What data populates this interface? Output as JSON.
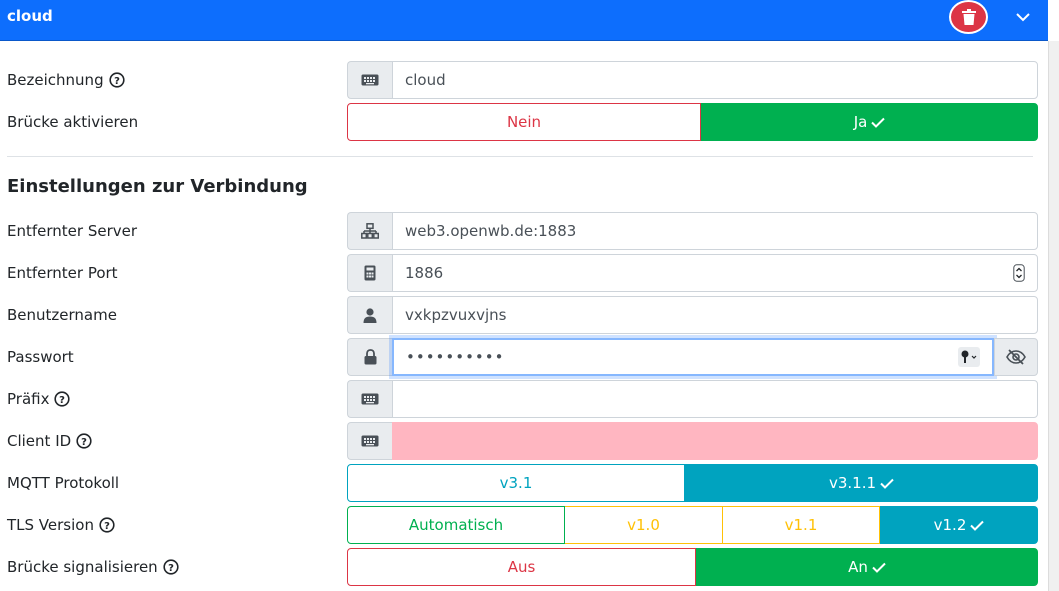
{
  "header": {
    "title": "cloud"
  },
  "fields": {
    "bezeichnung": {
      "label": "Bezeichnung",
      "value": "cloud"
    },
    "bruecke_aktivieren": {
      "label": "Brücke aktivieren",
      "options": [
        "Nein",
        "Ja"
      ],
      "selected": "Ja"
    },
    "section_title": "Einstellungen zur Verbindung",
    "server": {
      "label": "Entfernter Server",
      "value": "web3.openwb.de:1883"
    },
    "port": {
      "label": "Entfernter Port",
      "value": "1886"
    },
    "username": {
      "label": "Benutzername",
      "value": "vxkpzvuxvjns"
    },
    "password": {
      "label": "Passwort",
      "value": "••••••••••"
    },
    "praefix": {
      "label": "Präfix",
      "value": ""
    },
    "client_id": {
      "label": "Client ID",
      "value": ""
    },
    "mqtt": {
      "label": "MQTT Protokoll",
      "options": [
        "v3.1",
        "v3.1.1"
      ],
      "selected": "v3.1.1"
    },
    "tls": {
      "label": "TLS Version",
      "options": [
        "Automatisch",
        "v1.0",
        "v1.1",
        "v1.2"
      ],
      "selected": "v1.2"
    },
    "signal": {
      "label": "Brücke signalisieren",
      "options": [
        "Aus",
        "An"
      ],
      "selected": "An"
    }
  },
  "colors": {
    "primary": "#0d6efd",
    "success": "#00b050",
    "danger": "#dc3545",
    "info": "#00a3bf",
    "warning": "#ffc107"
  }
}
